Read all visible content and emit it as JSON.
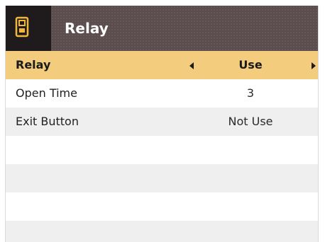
{
  "header": {
    "title": "Relay",
    "icon": "relay-device-icon",
    "background_color": "#5b4c4d",
    "icon_box_color": "#1f1a1b",
    "icon_color": "#f1b73c"
  },
  "rows": [
    {
      "label": "Relay",
      "value": "Use",
      "selected": true
    },
    {
      "label": "Open Time",
      "value": "3",
      "selected": false
    },
    {
      "label": "Exit Button",
      "value": "Not Use",
      "selected": false
    }
  ],
  "colors": {
    "selected_row": "#f4cc7e",
    "alt_row": "#efefef"
  }
}
